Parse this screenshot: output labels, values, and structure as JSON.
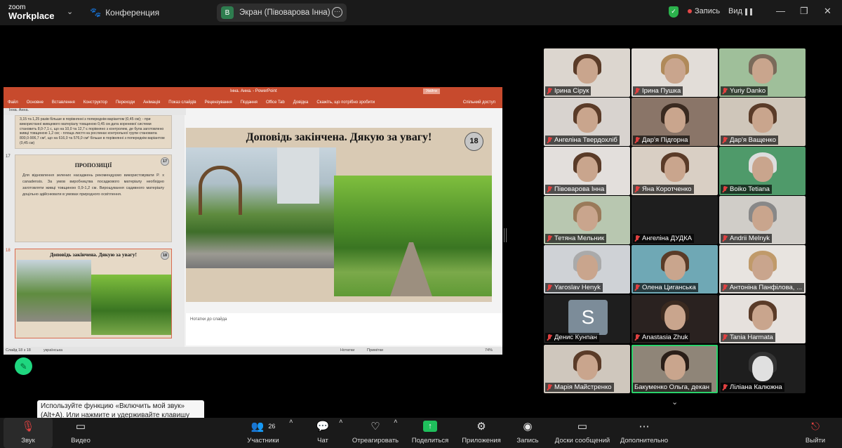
{
  "app": {
    "logo_line1": "zoom",
    "logo_line2": "Workplace",
    "conference": "Конференция"
  },
  "screen_share": {
    "avatar_letter": "В",
    "label": "Экран (Півоварова Інна)"
  },
  "top_right": {
    "recording": "Запись",
    "view": "Вид"
  },
  "powerpoint": {
    "window_title": "Інна. Анна. - PowerPoint",
    "login_button": "Увійти",
    "ribbon": [
      "Файл",
      "Основне",
      "Вставлення",
      "Конструктор",
      "Переходи",
      "Анімація",
      "Показ слайдів",
      "Рецензування",
      "Подання",
      "Office Tab",
      "Довідка",
      "Скажіть, що потрібно зробити"
    ],
    "share": "Спільний доступ",
    "doc_tab": "Інна. Анна.",
    "thumb16_text": "3,15 та 1,25 разів більше в порівнянні з попереднім варіантом (0,45 см); - при використанні живцевого матеріалу товщиною 0,45 см дата кореневої системи становить 8,0-7,1 с, що на 10,0 та 12,7 є порівняно з контролем, де була заготовлено живці товщиною 1,2 см; - площа листя на рослинах контрольної групи становила 800,0-906,7 см², що на 616,0 та 576,0 см² більше в порівнянні з попереднім варіантом (0,45 см)",
    "slide17_num": "17",
    "slide17_title": "ПРОПОЗИЦІЇ",
    "slide17_text": "Для відновлення зелених насаджень рекомендуємо використовувати P. x canadensis. За умов виробництва посадкового матеріалу необхідно заготовляти живці товщиною 0,9-1,2 см. Вирощування садивного матеріалу доцільно здійснювати в умовах природного освітлення.",
    "slide18_num": "18",
    "slide_title": "Доповідь закінчена.  Дякую за увагу!",
    "notes": "Нотатки до слайда",
    "status_slide": "Слайд 18 з 18",
    "status_lang": "українська",
    "status_notes": "Нотатки",
    "status_comments": "Примітки",
    "zoom": "74%"
  },
  "participants": [
    "Ірина Сірук",
    "Ірина Пушка",
    "Yuriy Danko",
    "Ангеліна Твердохліб",
    "Дар'я Підгорна",
    "Дар'я Ващенко",
    "Півоварова Інна",
    "Яна Коротченко",
    "Boiko Tetiana",
    "Тетяна Мельник",
    "Ангеліна ДУДКА",
    "Andrii Melnyk",
    "Yaroslav Henyk",
    "Олена Циганська",
    "Антоніна Панфілова, ...",
    "Денис Кунпан",
    "Anastasia Zhuk",
    "Tania Harmata",
    "Марія Майстренко",
    "Бакуменко Ольга, декан",
    "Ліліана Калюжна"
  ],
  "avatar_letter_s": "S",
  "tooltip": "Используйте функцию «Включить мой звук» (Alt+A). Или нажмите и удерживайте клавишу Space, чтобы временно включить звук.",
  "toolbar": {
    "audio": "Звук",
    "video": "Видео",
    "participants": "Участники",
    "participants_count": "26",
    "chat": "Чат",
    "react": "Отреагировать",
    "share": "Поделиться",
    "apps": "Приложения",
    "record": "Запись",
    "whiteboards": "Доски сообщений",
    "more": "Дополнительно",
    "leave": "Выйти"
  }
}
